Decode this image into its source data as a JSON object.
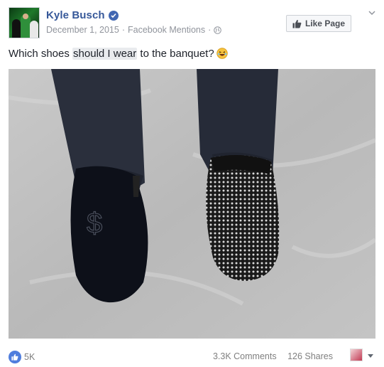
{
  "post": {
    "author": "Kyle Busch",
    "date": "December 1, 2015",
    "separator": "·",
    "via": "Facebook Mentions",
    "text_before": "Which shoes ",
    "text_highlight": "should I wear",
    "text_after": " to the banquet?",
    "like_page_label": "Like Page"
  },
  "footer": {
    "likes": "5K",
    "comments": "3.3K Comments",
    "shares": "126 Shares"
  },
  "icons": {
    "verified": "verified-badge-icon",
    "globe": "globe-icon",
    "thumbs_up": "thumbs-up-icon",
    "emoji": "laughing-emoji-icon",
    "menu": "chevron-down-icon"
  },
  "colors": {
    "name_link": "#365899",
    "meta": "#90949c",
    "like_blue": "#4f7ddd",
    "verified_blue": "#4267b2"
  }
}
